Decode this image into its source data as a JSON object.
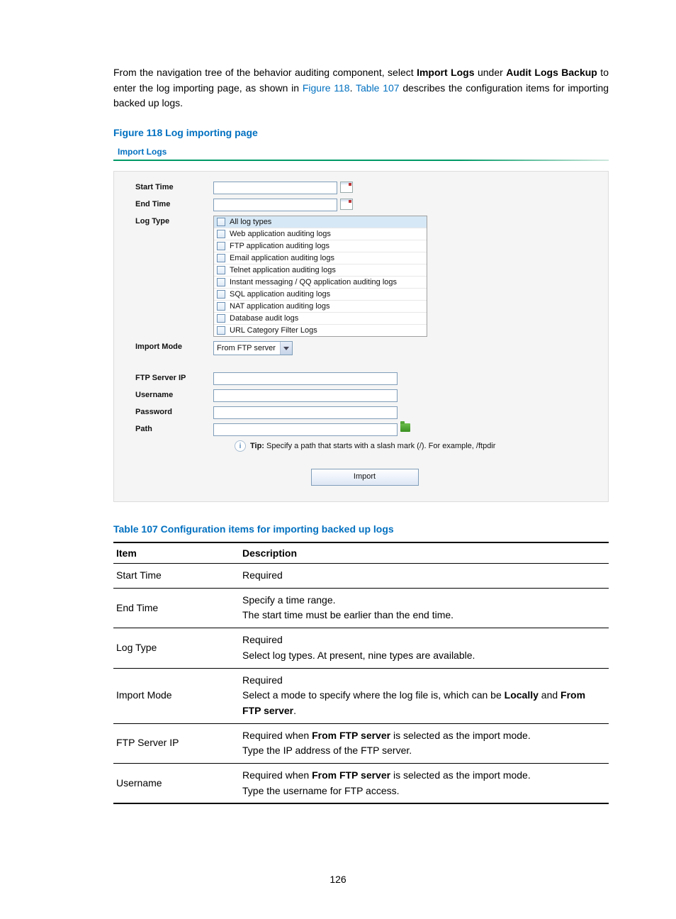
{
  "intro": {
    "t1": "From the navigation tree of the behavior auditing component, select ",
    "b1": "Import Logs",
    "t2": " under ",
    "b2": "Audit Logs Backup",
    "t3": " to enter the log importing page, as shown in ",
    "link1": "Figure 118",
    "t4": ". ",
    "link2": "Table 107",
    "t5": " describes the configuration items for importing backed up logs."
  },
  "figure_caption": "Figure 118 Log importing page",
  "panel_title": "Import Logs",
  "form": {
    "labels": {
      "start_time": "Start Time",
      "end_time": "End Time",
      "log_type": "Log Type",
      "import_mode": "Import Mode",
      "ftp_server_ip": "FTP Server IP",
      "username": "Username",
      "password": "Password",
      "path": "Path"
    },
    "log_types": [
      "All log types",
      "Web application auditing logs",
      "FTP application auditing logs",
      "Email application auditing logs",
      "Telnet application auditing logs",
      "Instant messaging / QQ application auditing logs",
      "SQL application auditing logs",
      "NAT application auditing logs",
      "Database audit logs",
      "URL Category Filter Logs"
    ],
    "import_mode_value": "From FTP server",
    "tip_bold": "Tip:",
    "tip_text": " Specify a path that starts with a slash mark (/). For example, /ftpdir",
    "import_button": "Import"
  },
  "table_caption": "Table 107 Configuration items for importing backed up logs",
  "table": {
    "headers": [
      "Item",
      "Description"
    ],
    "rows": [
      {
        "item": "Start Time",
        "desc_html": "Required"
      },
      {
        "item": "End Time",
        "desc_html": "Specify a time range.<br>The start time must be earlier than the end time."
      },
      {
        "item": "Log Type",
        "desc_html": "Required<br>Select log types. At present, nine types are available."
      },
      {
        "item": "Import Mode",
        "desc_html": "Required<br>Select a mode to specify where the log file is, which can be <b>Locally</b> and <b>From FTP server</b>."
      },
      {
        "item": "FTP Server IP",
        "desc_html": "Required when <b>From FTP server</b> is selected as the import mode.<br>Type the IP address of the FTP server."
      },
      {
        "item": "Username",
        "desc_html": "Required when <b>From FTP server</b> is selected as the import mode.<br>Type the username for FTP access."
      }
    ]
  },
  "page_number": "126"
}
